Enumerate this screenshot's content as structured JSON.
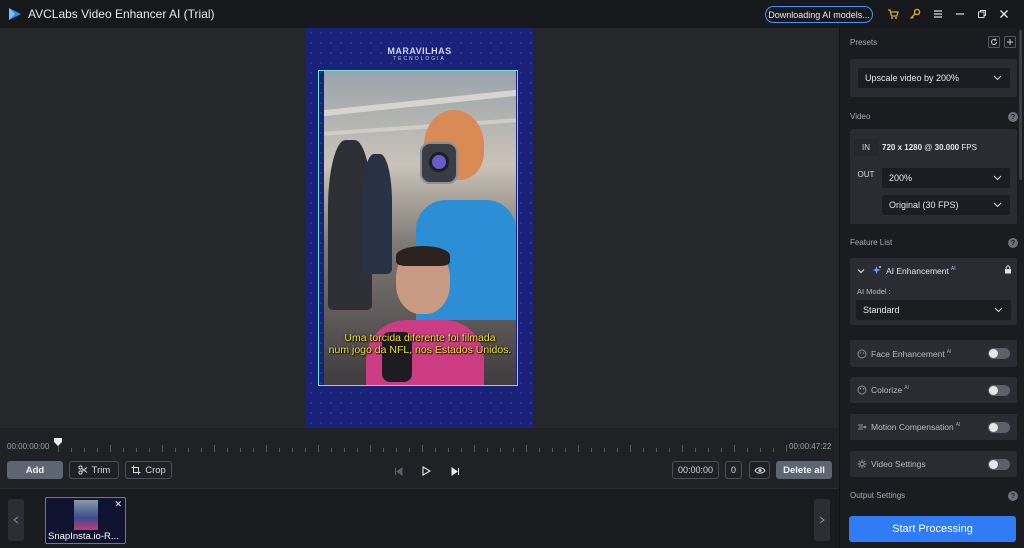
{
  "app": {
    "title": "AVCLabs Video Enhancer AI (Trial)",
    "downloading": "Downloading AI models..."
  },
  "video": {
    "watermark": "MARAVILHAS",
    "watermark_sub": "TECNOLOGIA",
    "caption_line1": "Uma torcida diferente foi filmada",
    "caption_line2": "num jogo da NFL, nos Estados Unidos."
  },
  "timeline": {
    "start": "00:00:00:00",
    "end": "00:00:47:22"
  },
  "controls": {
    "add": "Add",
    "trim": "Trim",
    "crop": "Crop",
    "time": "00:00:00",
    "frame": "0",
    "delete_all": "Delete all"
  },
  "media": {
    "thumb_label": "SnapInsta.io-R..."
  },
  "panel": {
    "presets_title": "Presets",
    "preset_value": "Upscale video by 200%",
    "video_title": "Video",
    "in_label": "IN",
    "in_res": "720 x 1280",
    "in_at": "@",
    "in_fps": "30.000",
    "in_fps_unit": "FPS",
    "out_label": "OUT",
    "out_scale": "200%",
    "out_fps": "Original (30 FPS)",
    "feature_title": "Feature List",
    "ai_enh_label": "AI Enhancement",
    "ai_sup": "AI",
    "ai_model_label": "AI Model :",
    "ai_model_value": "Standard",
    "face_label": "Face Enhancement",
    "colorize_label": "Colorize",
    "motion_label": "Motion Compensation",
    "video_settings_label": "Video Settings",
    "output_title": "Output Settings",
    "start": "Start Processing"
  },
  "colors": {
    "accent": "#2f7cf6",
    "caption": "#f4e52a",
    "crop": "#6fe2d6",
    "toolbar_icon": "#e0a23a"
  }
}
